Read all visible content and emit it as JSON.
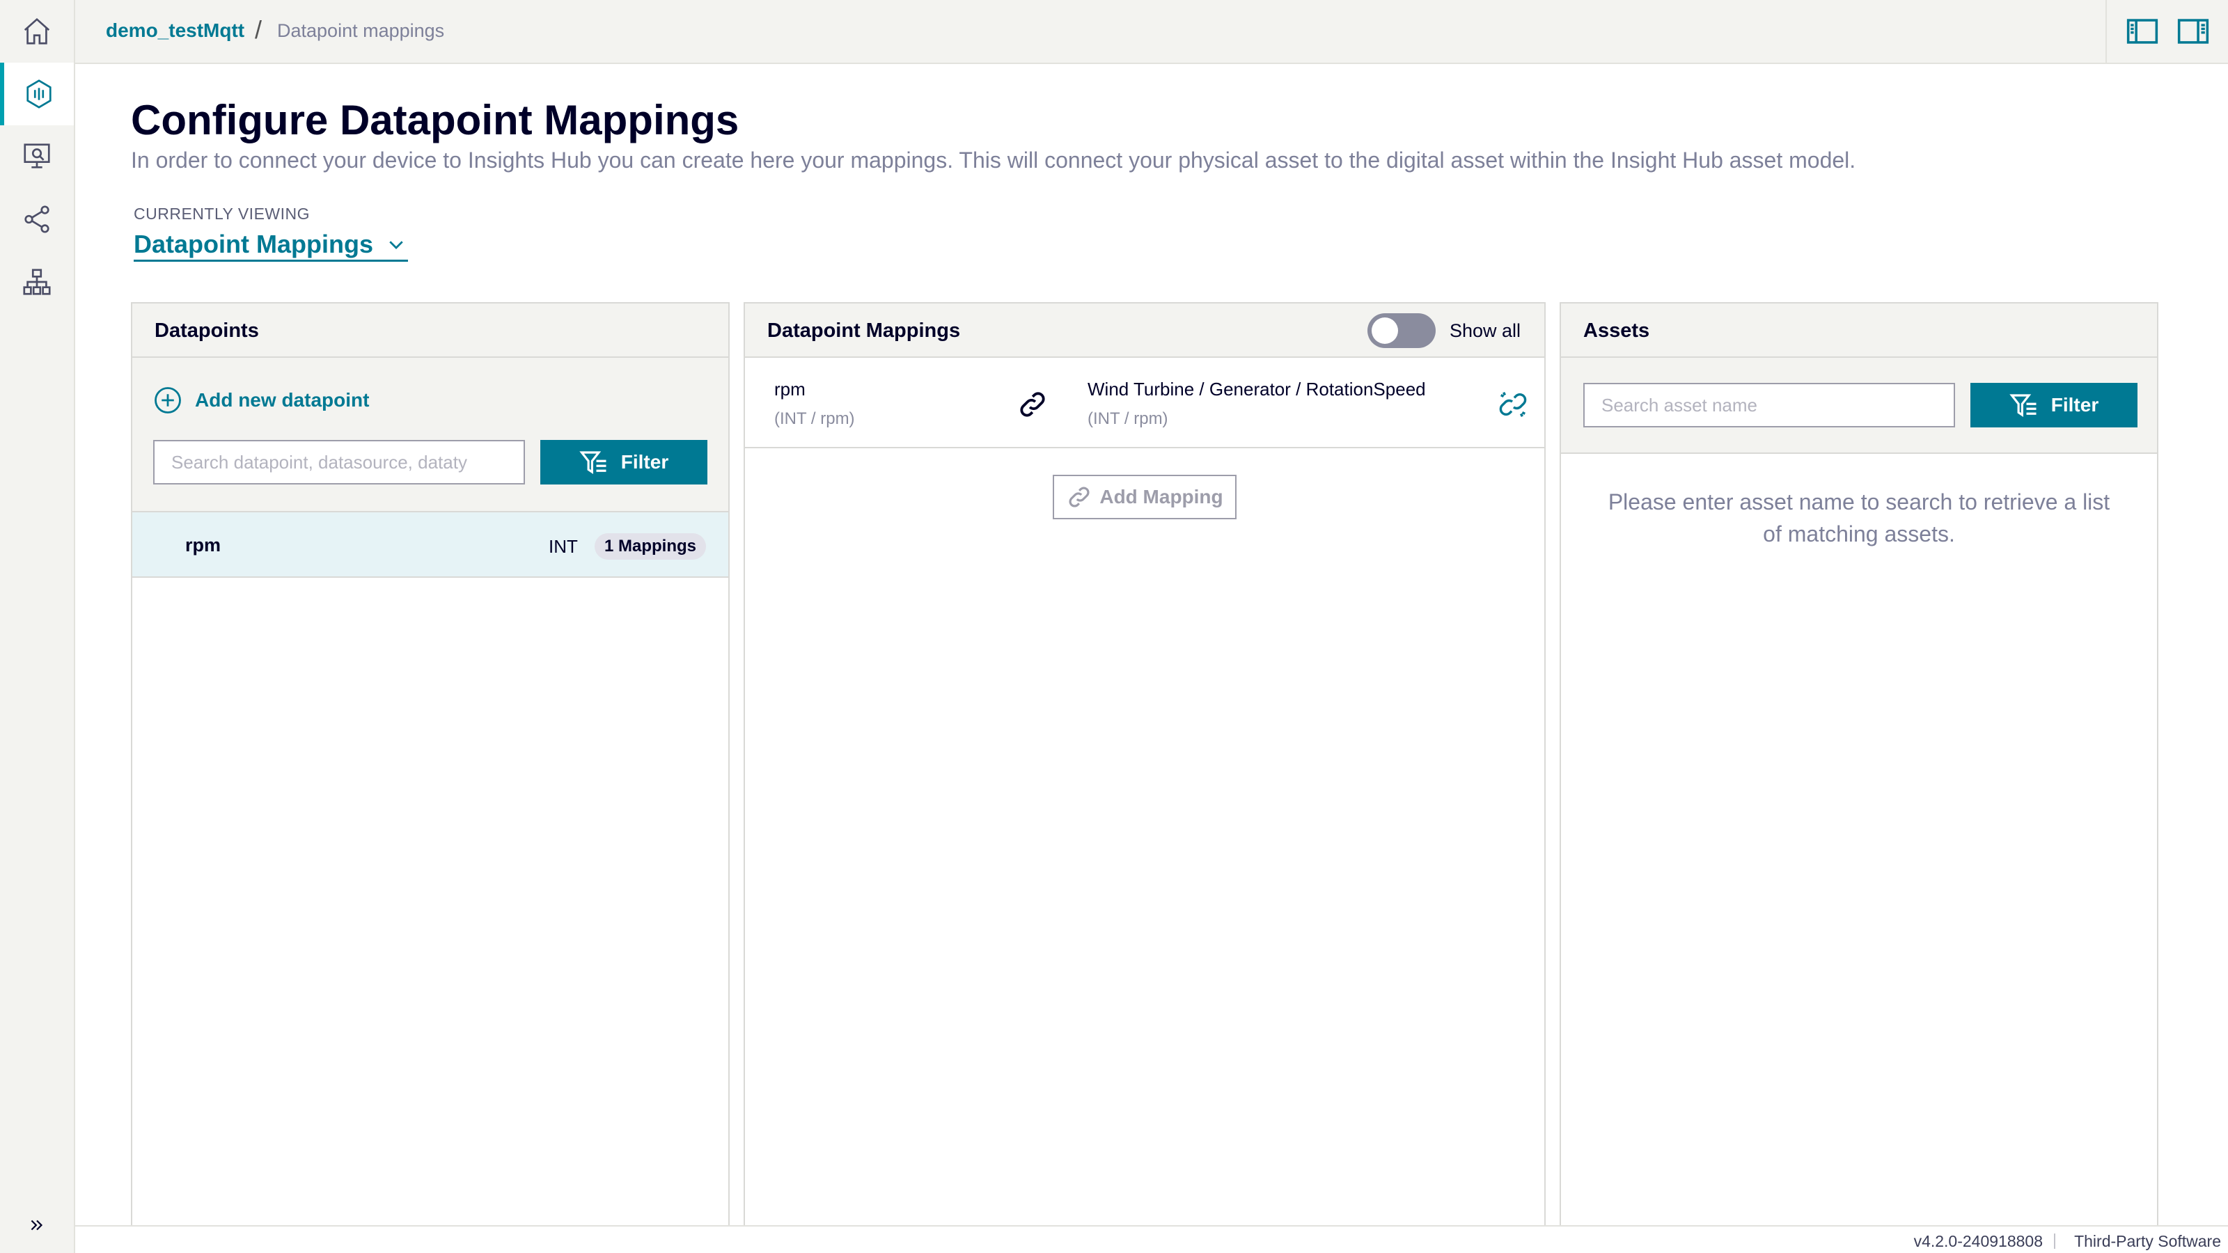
{
  "colors": {
    "accent": "#007993",
    "accent_light": "#00a0b0",
    "selected_row": "#e6f3f6",
    "panel_header": "#f3f3f0",
    "text_muted": "#7d8099"
  },
  "sidebar": {
    "items": [
      {
        "name": "home",
        "icon": "home-icon"
      },
      {
        "name": "device-config",
        "icon": "device-config-icon",
        "active": true
      },
      {
        "name": "monitor",
        "icon": "monitor-search-icon"
      },
      {
        "name": "share",
        "icon": "share-nodes-icon"
      },
      {
        "name": "hierarchy",
        "icon": "hierarchy-icon"
      }
    ],
    "expand_icon": "double-chevron-right-icon"
  },
  "header": {
    "breadcrumb_app": "demo_testMqtt",
    "breadcrumb_separator": "/",
    "breadcrumb_page": "Datapoint mappings"
  },
  "page": {
    "title": "Configure Datapoint Mappings",
    "description": "In order to connect your device to Insights Hub you can create here your mappings. This will connect your physical asset to the digital asset within the Insight Hub asset model.",
    "viewing_label": "CURRENTLY VIEWING",
    "viewing_value": "Datapoint Mappings"
  },
  "datapoints": {
    "title": "Datapoints",
    "add_label": "Add new datapoint",
    "search_placeholder": "Search datapoint, datasource, dataty",
    "filter_label": "Filter",
    "rows": [
      {
        "name": "rpm",
        "type": "INT",
        "badge": "1 Mappings"
      }
    ]
  },
  "mappings": {
    "title": "Datapoint Mappings",
    "show_all_label": "Show all",
    "show_all_on": false,
    "rows": [
      {
        "source_name": "rpm",
        "source_meta": "(INT / rpm)",
        "target_name": "Wind Turbine / Generator / RotationSpeed",
        "target_meta": "(INT / rpm)"
      }
    ],
    "add_label": "Add Mapping"
  },
  "assets": {
    "title": "Assets",
    "search_placeholder": "Search asset name",
    "filter_label": "Filter",
    "empty_message": "Please enter asset name to search to retrieve a list of matching assets."
  },
  "footer": {
    "version": "v4.2.0-240918808",
    "separator": "|",
    "third_party": "Third-Party Software"
  }
}
